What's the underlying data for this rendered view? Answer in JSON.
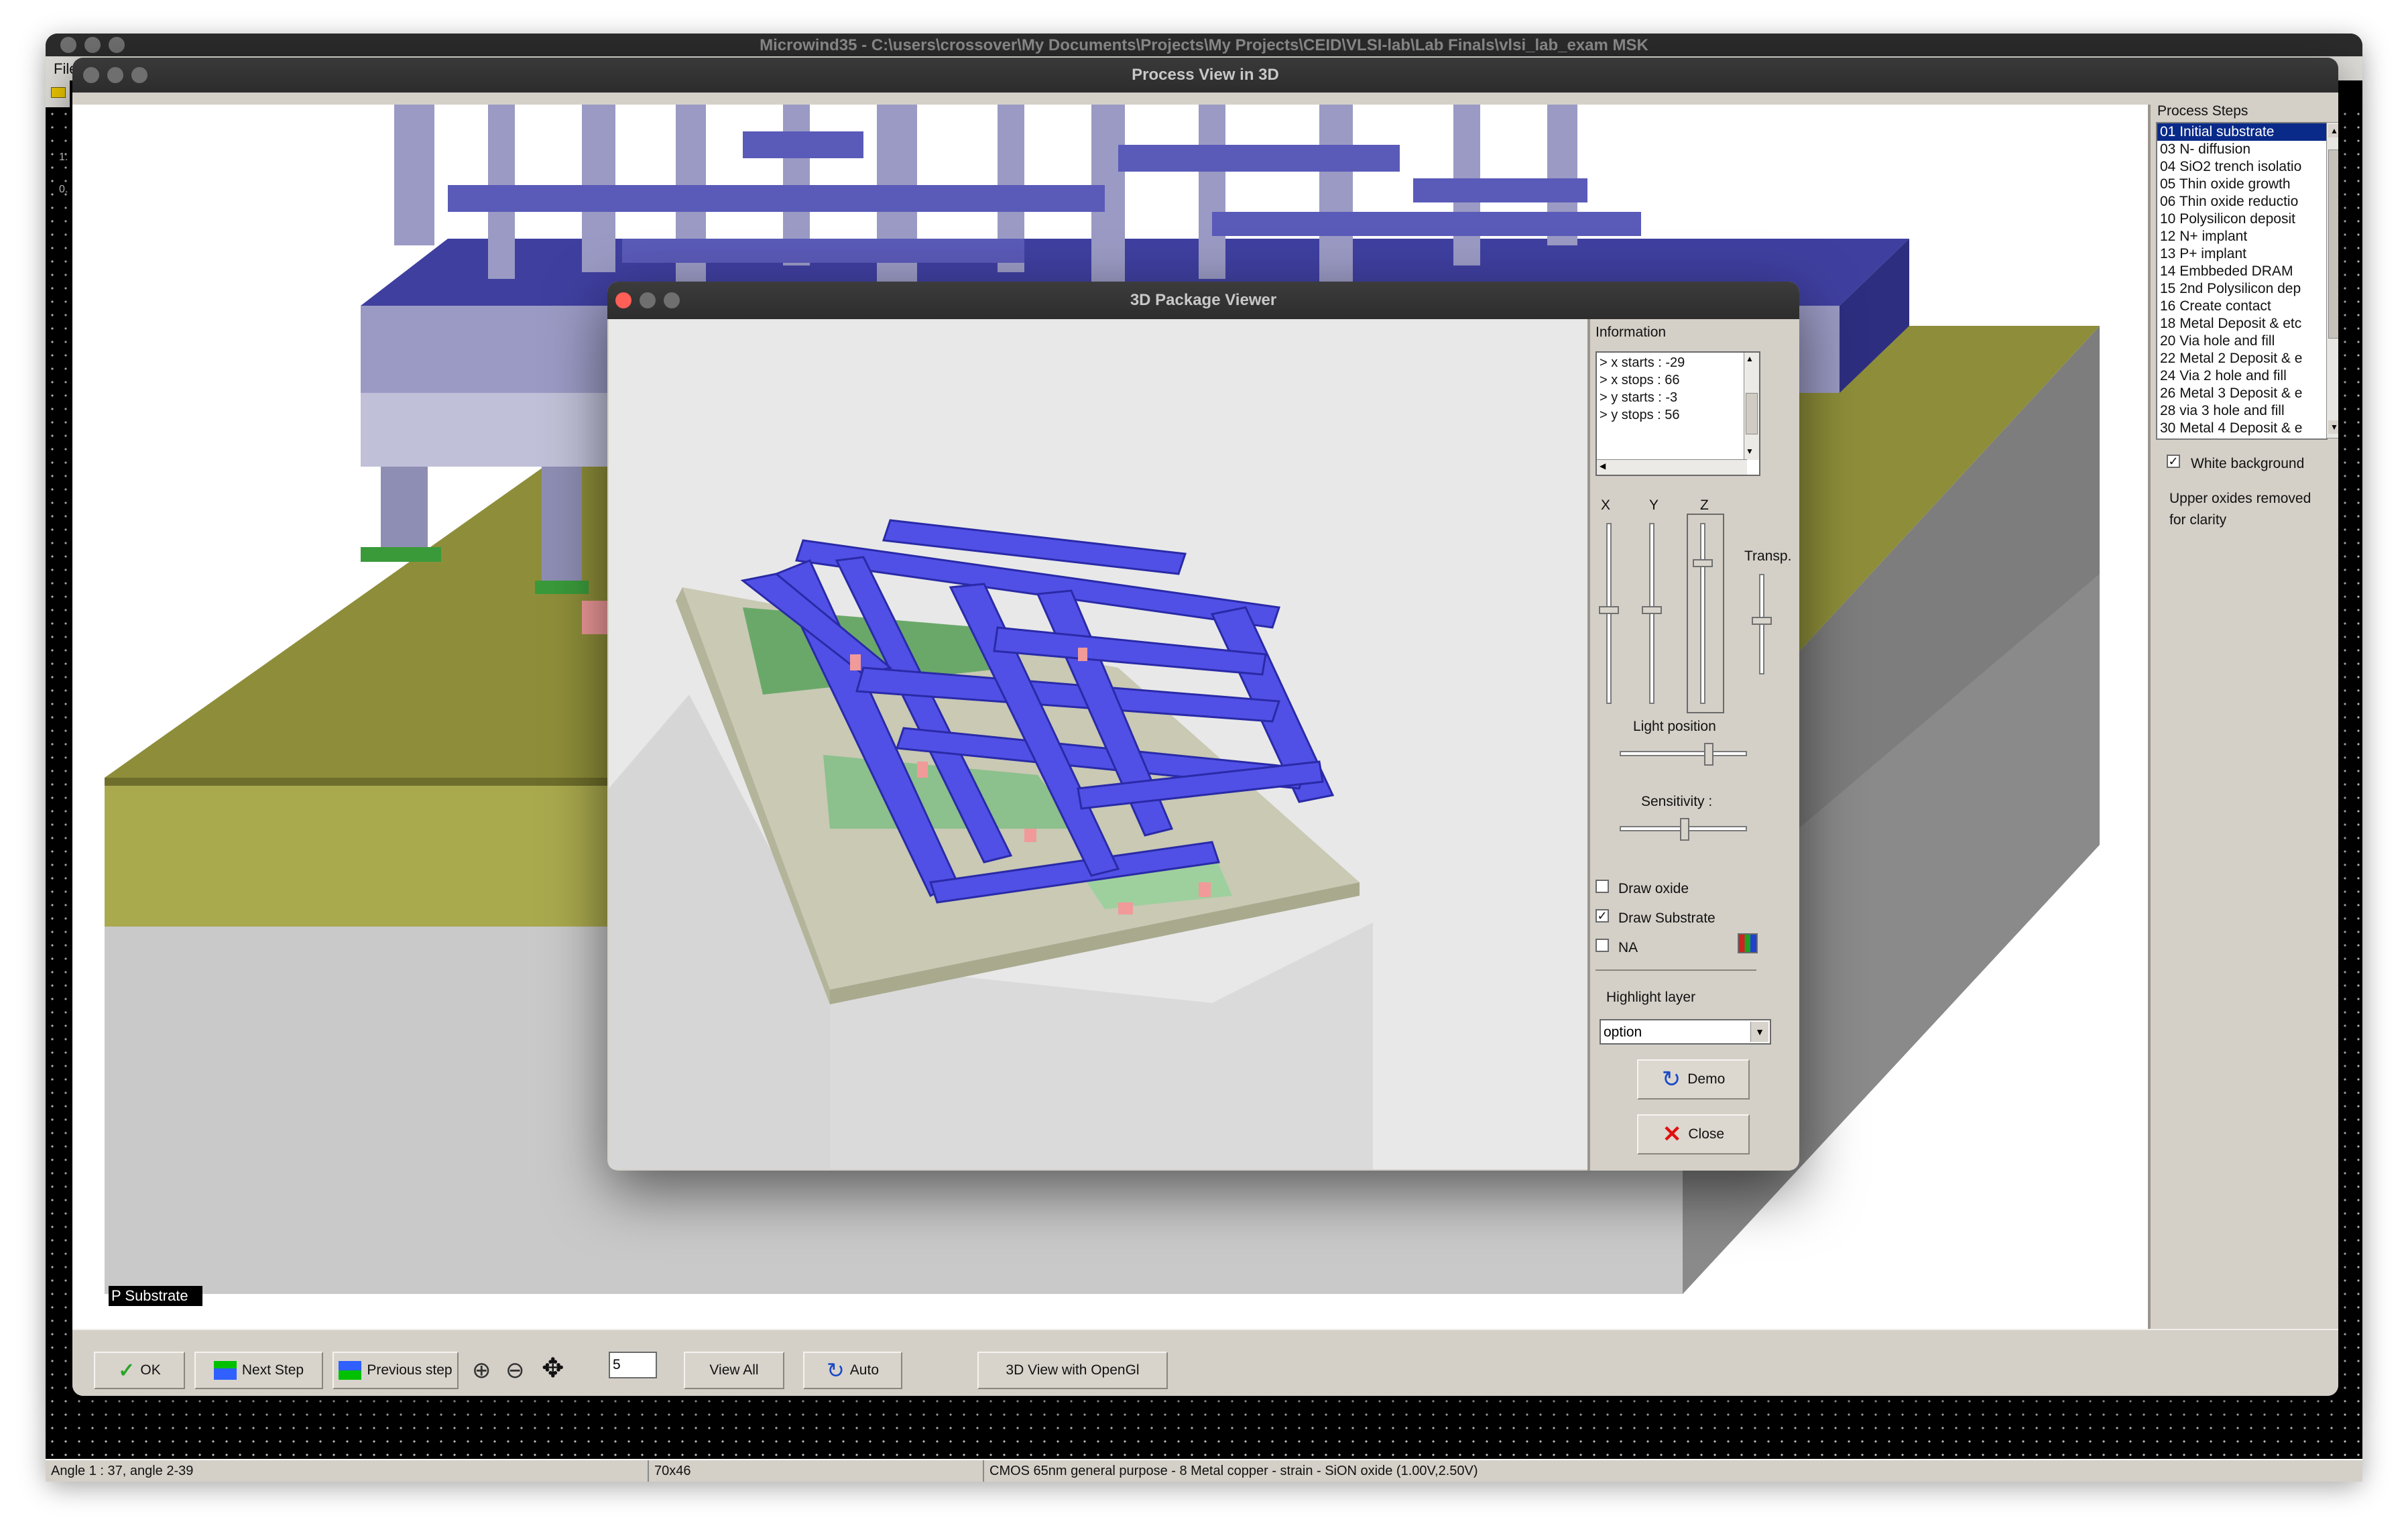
{
  "back_window": {
    "title": "Microwind35 - C:\\users\\crossover\\My Documents\\Projects\\My Projects\\CEID\\VLSI-lab\\Lab Finals\\vlsi_lab_exam MSK",
    "menu_first": "File",
    "ruler_tick_1": "1.",
    "ruler_tick_2": "0."
  },
  "process_window": {
    "title": "Process View in 3D",
    "scene_label": "P Substrate",
    "process_steps_heading": "Process Steps",
    "process_steps": [
      "01 Initial substrate",
      "03 N- diffusion",
      "04 SiO2 trench isolatio",
      "05 Thin oxide growth",
      "06 Thin oxide reductio",
      "10 Polysilicon deposit",
      "12 N+ implant",
      "13 P+ implant",
      "14 Embbeded DRAM",
      "15 2nd Polysilicon dep",
      "16 Create contact",
      "18 Metal Deposit & etc",
      "20 Via hole and fill",
      "22 Metal 2 Deposit & e",
      "24 Via 2 hole and fill",
      "26 Metal 3 Deposit & e",
      "28 via 3 hole and fill",
      "30 Metal 4 Deposit & e"
    ],
    "selected_step_index": 0,
    "white_background_label": "White background",
    "white_background_checked": true,
    "note_line1": "Upper oxides removed",
    "note_line2": "for clarity"
  },
  "toolbar": {
    "ok": "OK",
    "next_step": "Next Step",
    "previous_step": "Previous step",
    "step_value": "5",
    "view_all": "View All",
    "auto": "Auto",
    "opengl": "3D View with OpenGl"
  },
  "viewer": {
    "title": "3D Package Viewer",
    "information_label": "Information",
    "info_lines": [
      "> x starts : -29",
      "> x stops : 66",
      "> y starts : -3",
      "> y stops : 56"
    ],
    "axis_x": "X",
    "axis_y": "Y",
    "axis_z": "Z",
    "transp_label": "Transp.",
    "light_label": "Light position",
    "sensitivity_label": "Sensitivity :",
    "draw_oxide_label": "Draw oxide",
    "draw_oxide_checked": false,
    "draw_substrate_label": "Draw Substrate",
    "draw_substrate_checked": true,
    "na_label": "NA",
    "na_checked": false,
    "highlight_label": "Highlight layer",
    "highlight_value": "option",
    "demo_button": "Demo",
    "close_button": "Close"
  },
  "statusbar": {
    "angle": "Angle 1 : 37, angle 2-39",
    "grid": "70x46",
    "technology": "CMOS 65nm general purpose - 8 Metal copper - strain - SiON oxide (1.00V,2.50V)"
  },
  "colors": {
    "metal_dark": "#3f3fa0",
    "metal_light": "#6868d8",
    "substrate_olive": "#a9a94e",
    "selection_blue": "#0a2a8a"
  }
}
